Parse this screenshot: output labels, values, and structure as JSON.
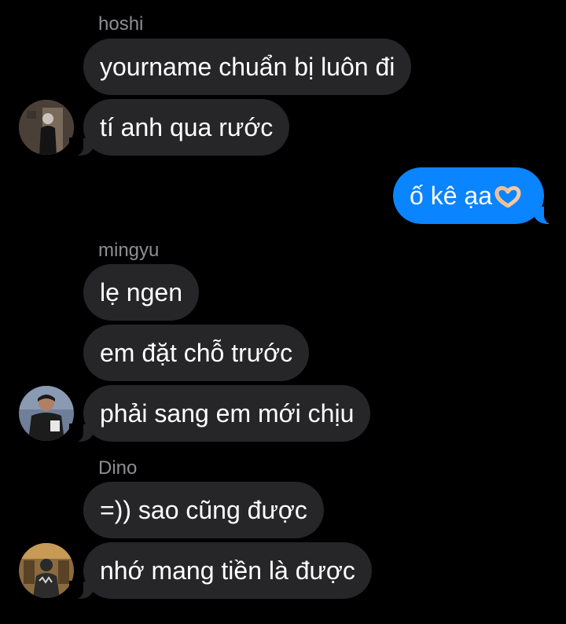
{
  "conversation": {
    "groups": [
      {
        "sender": "hoshi",
        "messages": [
          "yourname chuẩn bị luôn đi",
          "tí anh qua rước"
        ],
        "avatar_icon": "profile-photo-hoshi"
      },
      {
        "outgoing": [
          "ố kê ạa"
        ],
        "emoji_icon": "heart-hands-emoji"
      },
      {
        "sender": "mingyu",
        "messages": [
          "lẹ ngen",
          "em đặt chỗ trước",
          "phải sang em mới chịu"
        ],
        "avatar_icon": "profile-photo-mingyu"
      },
      {
        "sender": "Dino",
        "messages": [
          "=)) sao cũng được",
          "nhớ mang tiền là được"
        ],
        "avatar_icon": "profile-photo-dino"
      }
    ]
  },
  "colors": {
    "background": "#000000",
    "incoming_bubble": "#262628",
    "outgoing_bubble": "#0a84ff",
    "sender_name": "#8e8e93",
    "text": "#ffffff"
  }
}
